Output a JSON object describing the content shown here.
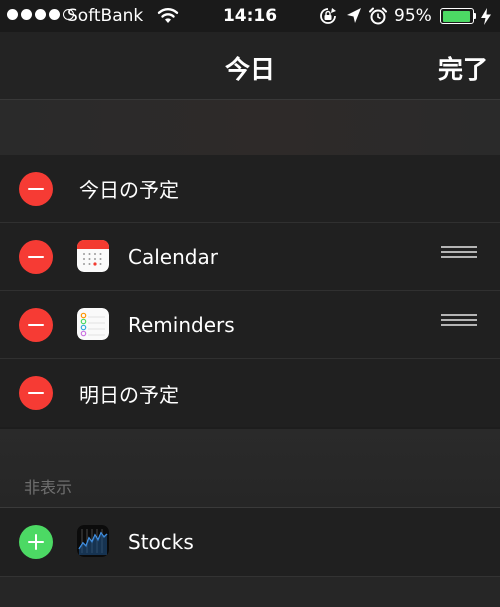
{
  "status_bar": {
    "carrier": "SoftBank",
    "time": "14:16",
    "battery_percent": "95%",
    "battery_level": 0.95,
    "icons": [
      "signal-dots",
      "wifi-icon",
      "rotation-lock-icon",
      "location-arrow-icon",
      "alarm-icon",
      "battery-icon",
      "charging-bolt-icon"
    ]
  },
  "nav": {
    "title": "今日",
    "done_label": "完了"
  },
  "shown": {
    "items": [
      {
        "label": "今日の予定"
      },
      {
        "label": "Calendar",
        "icon": "calendar-icon"
      },
      {
        "label": "Reminders",
        "icon": "reminders-icon"
      },
      {
        "label": "明日の予定"
      }
    ]
  },
  "hidden": {
    "header": "非表示",
    "items": [
      {
        "label": "Stocks",
        "icon": "stocks-icon"
      }
    ]
  },
  "colors": {
    "remove": "#f63b34",
    "add": "#4cd964",
    "battery": "#4cd964"
  }
}
